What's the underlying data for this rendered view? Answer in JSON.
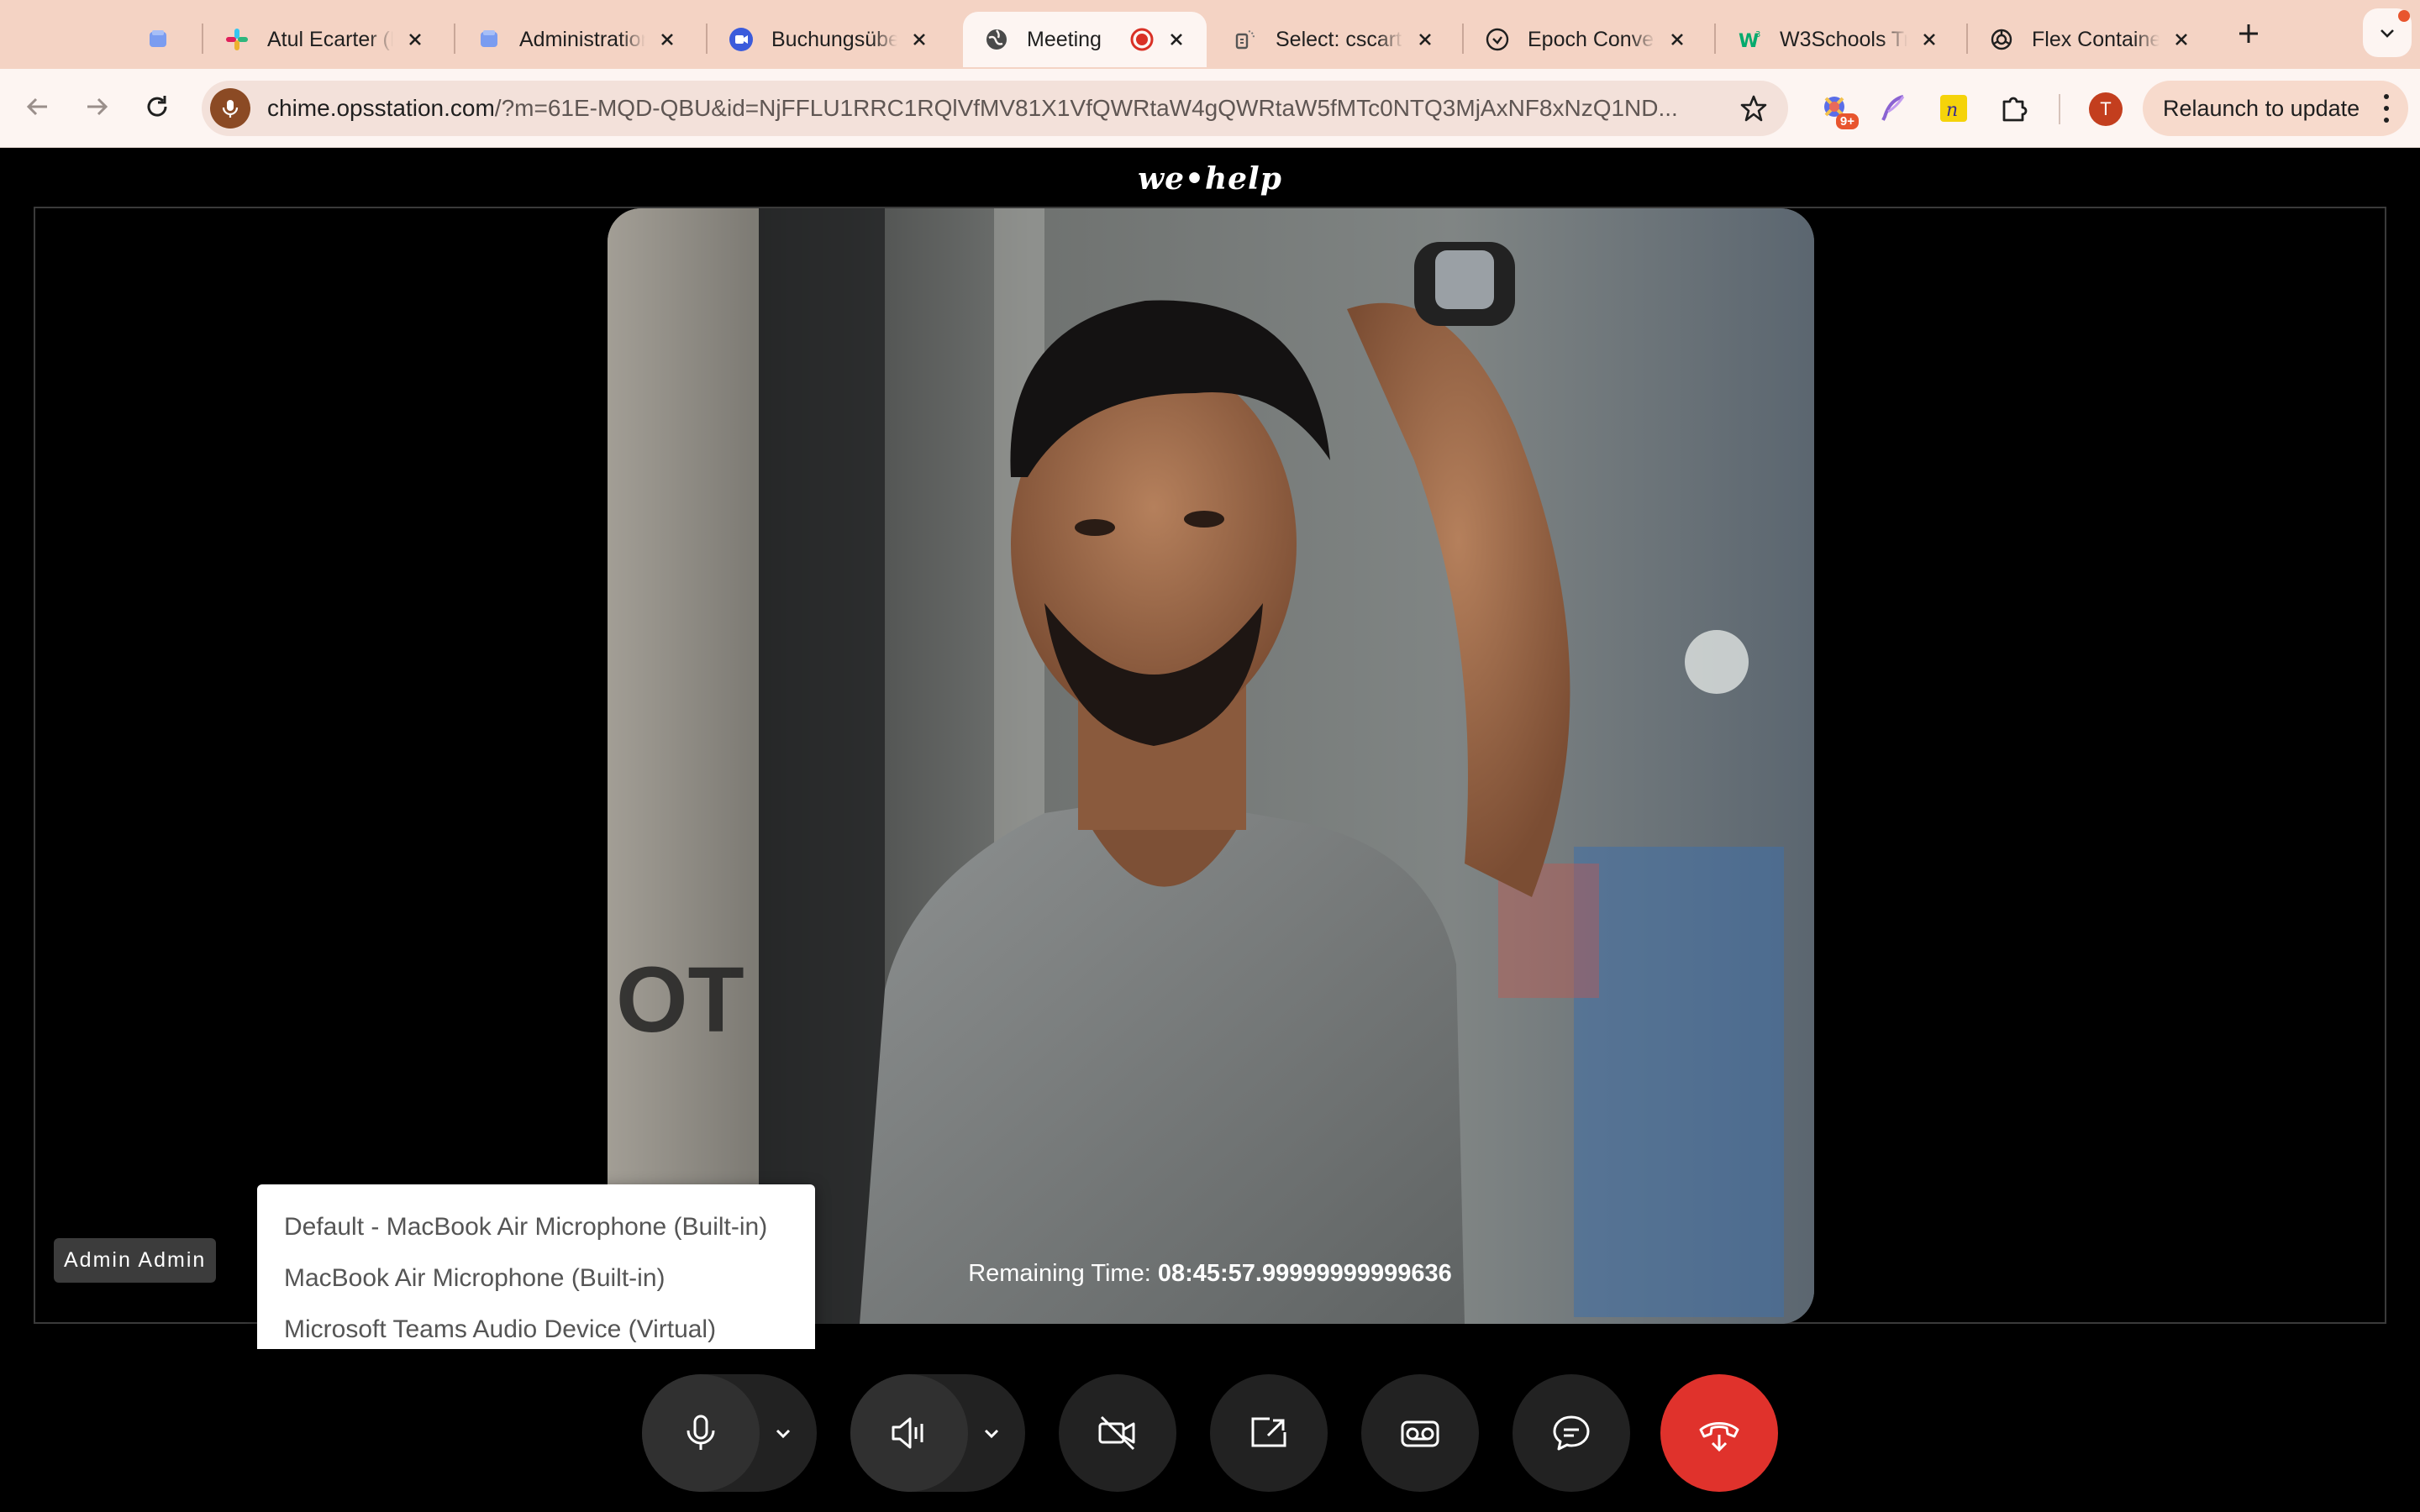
{
  "browser": {
    "tabs": [
      {
        "title": "",
        "icon": "app-icon",
        "active": false
      },
      {
        "title": "Atul Ecarter (D",
        "icon": "slack-icon",
        "active": false
      },
      {
        "title": "Administration",
        "icon": "app-icon",
        "active": false
      },
      {
        "title": "Buchungsübe",
        "icon": "video-icon",
        "active": false
      },
      {
        "title": "Meeting",
        "icon": "globe-icon",
        "active": true,
        "recording": true
      },
      {
        "title": "Select: cscart",
        "icon": "db-icon",
        "active": false
      },
      {
        "title": "Epoch Conver",
        "icon": "clock-icon",
        "active": false
      },
      {
        "title": "W3Schools Tr",
        "icon": "w3schools-icon",
        "active": false
      },
      {
        "title": "Flex Containe",
        "icon": "openai-icon",
        "active": false
      }
    ],
    "url_host": "chime.opsstation.com",
    "url_rest": "/?m=61E-MQD-QBU&id=NjFFLU1RRC1RQlVfMV81X1VfQWRtaW4gQWRtaW5fMTc0NTQ3MjAxNF8xNzQ1ND...",
    "extension_badge": "9+",
    "profile_initial": "T",
    "relaunch_label": "Relaunch to update"
  },
  "meeting": {
    "brand": "we•help",
    "participant_name": "Admin Admin",
    "remaining_label": "Remaining Time:",
    "remaining_value": "08:45:57.99999999999636",
    "mic_options": [
      "Default - MacBook Air Microphone (Built-in)",
      "MacBook Air Microphone (Built-in)",
      "Microsoft Teams Audio Device (Virtual)"
    ],
    "colors": {
      "end_call": "#e0322c",
      "tabstrip": "#f4d3c4",
      "toolbar": "#fdf5f2"
    }
  }
}
